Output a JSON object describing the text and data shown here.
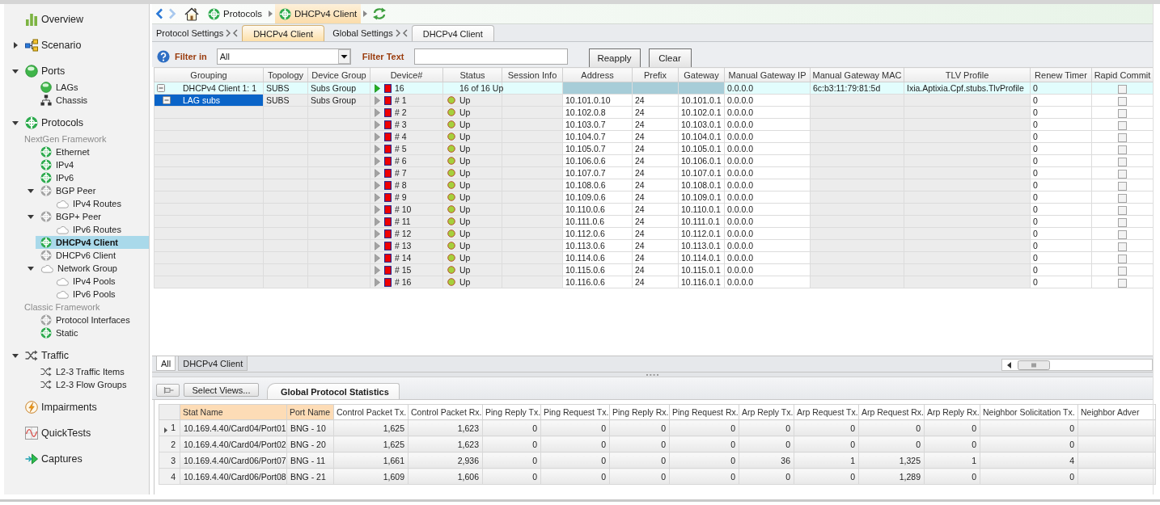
{
  "sidebar": {
    "items": [
      {
        "kind": "overview",
        "label": "Overview",
        "selected": false
      },
      {
        "kind": "scenario",
        "label": "Scenario",
        "selected": false,
        "expanded": false
      },
      {
        "kind": "ports",
        "label": "Ports",
        "selected": false,
        "expanded": true,
        "children": [
          {
            "kind": "lag",
            "label": "LAGs",
            "selected": false
          },
          {
            "kind": "chassis",
            "label": "Chassis",
            "selected": false
          }
        ]
      },
      {
        "kind": "protocol",
        "label": "Protocols",
        "active": true,
        "selected": false,
        "expanded": true,
        "children": [
          {
            "kind": "heading",
            "label": "NextGen Framework"
          },
          {
            "kind": "protocol",
            "label": "Ethernet",
            "active": true,
            "selected": false
          },
          {
            "kind": "protocol",
            "label": "IPv4",
            "active": true,
            "selected": false
          },
          {
            "kind": "protocol",
            "label": "IPv6",
            "active": true,
            "selected": false
          },
          {
            "kind": "protocol",
            "label": "BGP Peer",
            "active": false,
            "selected": false,
            "expanded": true,
            "children": [
              {
                "kind": "cloud",
                "label": "IPv4 Routes",
                "selected": false
              }
            ]
          },
          {
            "kind": "protocol",
            "label": "BGP+ Peer",
            "active": false,
            "selected": false,
            "expanded": true,
            "children": [
              {
                "kind": "cloud",
                "label": "IPv6 Routes",
                "selected": false
              }
            ]
          },
          {
            "kind": "protocol",
            "label": "DHCPv4 Client",
            "active": true,
            "selected": true
          },
          {
            "kind": "protocol",
            "label": "DHCPv6 Client",
            "active": false,
            "selected": false
          },
          {
            "kind": "cloud",
            "label": "Network Group",
            "selected": false,
            "expanded": true,
            "children": [
              {
                "kind": "cloud",
                "label": "IPv4 Pools",
                "selected": false
              },
              {
                "kind": "cloud",
                "label": "IPv6 Pools",
                "selected": false
              }
            ]
          },
          {
            "kind": "heading",
            "label": "Classic Framework"
          },
          {
            "kind": "protocol",
            "label": "Protocol Interfaces",
            "active": false,
            "selected": false
          },
          {
            "kind": "protocol",
            "label": "Static",
            "active": true,
            "selected": false
          }
        ]
      },
      {
        "kind": "traffic",
        "label": "Traffic",
        "selected": false,
        "expanded": true,
        "children": [
          {
            "kind": "traffic",
            "label": "L2-3 Traffic Items",
            "selected": false
          },
          {
            "kind": "traffic",
            "label": "L2-3 Flow Groups",
            "selected": false
          }
        ]
      },
      {
        "kind": "impairments",
        "label": "Impairments",
        "selected": false
      },
      {
        "kind": "quicktests",
        "label": "QuickTests",
        "selected": false
      },
      {
        "kind": "captures",
        "label": "Captures",
        "selected": false
      }
    ]
  },
  "navigation": {
    "back_enabled": true,
    "forward_enabled": false
  },
  "breadcrumb": [
    {
      "label": "Protocols",
      "selected": false
    },
    {
      "label": "DHCPv4 Client",
      "selected": true
    }
  ],
  "settings_tabs": [
    {
      "label": "Protocol Settings",
      "tabs": [
        {
          "label": "DHCPv4 Client",
          "selected": true
        }
      ]
    },
    {
      "label": "Global Settings",
      "tabs": [
        {
          "label": "DHCPv4 Client",
          "selected": false
        }
      ]
    }
  ],
  "filter": {
    "scope_label": "Filter in",
    "scope": "All",
    "text_label": "Filter Text",
    "buttons": [
      "Reapply",
      "Clear"
    ]
  },
  "grid": {
    "columns": [
      {
        "label": "Grouping",
        "editable": false
      },
      {
        "label": "Topology",
        "editable": false
      },
      {
        "label": "Device Group",
        "editable": false
      },
      {
        "label": "Device#",
        "editable": false
      },
      {
        "label": "Status",
        "editable": false
      },
      {
        "label": "Session Info",
        "editable": false
      },
      {
        "label": "Address",
        "editable": true
      },
      {
        "label": "Prefix",
        "editable": true
      },
      {
        "label": "Gateway",
        "editable": true
      },
      {
        "label": "Manual Gateway IP",
        "editable": true
      },
      {
        "label": "Manual Gateway MAC",
        "editable": false
      },
      {
        "label": "TLV Profile",
        "editable": false
      },
      {
        "label": "Renew Timer",
        "editable": true
      },
      {
        "label": "Rapid Commit",
        "editable": true
      }
    ],
    "rows": [
      {
        "grouping": "DHCPv4 Client 1: 1",
        "topology": "SUBS",
        "device_group": "Subs Group",
        "device": "16",
        "status": "16 of 16 Up",
        "manual_gateway_ip": "0.0.0.0",
        "manual_gateway_mac": "6c:b3:11:79:81:5d",
        "tlv_profile": "Ixia.Aptixia.Cpf.stubs.TlvProfile",
        "renew_timer": "0",
        "rapid_commit": false,
        "expanded": true,
        "selected": false,
        "children": [
          {
            "grouping": "LAG subs",
            "topology": "SUBS",
            "device_group": "Subs Group",
            "expanded": true,
            "selected": true,
            "devices": [
              {
                "device": "# 1",
                "status": "Up",
                "address": "10.101.0.10",
                "prefix": "24",
                "gateway": "10.101.0.1",
                "manual_gateway_ip": "0.0.0.0",
                "renew_timer": "0",
                "rapid_commit": false,
                "selected": false
              },
              {
                "device": "# 2",
                "status": "Up",
                "address": "10.102.0.8",
                "prefix": "24",
                "gateway": "10.102.0.1",
                "manual_gateway_ip": "0.0.0.0",
                "renew_timer": "0",
                "rapid_commit": false,
                "selected": false
              },
              {
                "device": "# 3",
                "status": "Up",
                "address": "10.103.0.7",
                "prefix": "24",
                "gateway": "10.103.0.1",
                "manual_gateway_ip": "0.0.0.0",
                "renew_timer": "0",
                "rapid_commit": false,
                "selected": false
              },
              {
                "device": "# 4",
                "status": "Up",
                "address": "10.104.0.7",
                "prefix": "24",
                "gateway": "10.104.0.1",
                "manual_gateway_ip": "0.0.0.0",
                "renew_timer": "0",
                "rapid_commit": false,
                "selected": false
              },
              {
                "device": "# 5",
                "status": "Up",
                "address": "10.105.0.7",
                "prefix": "24",
                "gateway": "10.105.0.1",
                "manual_gateway_ip": "0.0.0.0",
                "renew_timer": "0",
                "rapid_commit": false,
                "selected": false
              },
              {
                "device": "# 6",
                "status": "Up",
                "address": "10.106.0.6",
                "prefix": "24",
                "gateway": "10.106.0.1",
                "manual_gateway_ip": "0.0.0.0",
                "renew_timer": "0",
                "rapid_commit": false,
                "selected": false
              },
              {
                "device": "# 7",
                "status": "Up",
                "address": "10.107.0.7",
                "prefix": "24",
                "gateway": "10.107.0.1",
                "manual_gateway_ip": "0.0.0.0",
                "renew_timer": "0",
                "rapid_commit": false,
                "selected": false
              },
              {
                "device": "# 8",
                "status": "Up",
                "address": "10.108.0.6",
                "prefix": "24",
                "gateway": "10.108.0.1",
                "manual_gateway_ip": "0.0.0.0",
                "renew_timer": "0",
                "rapid_commit": false,
                "selected": false
              },
              {
                "device": "# 9",
                "status": "Up",
                "address": "10.109.0.6",
                "prefix": "24",
                "gateway": "10.109.0.1",
                "manual_gateway_ip": "0.0.0.0",
                "renew_timer": "0",
                "rapid_commit": false,
                "selected": false
              },
              {
                "device": "# 10",
                "status": "Up",
                "address": "10.110.0.6",
                "prefix": "24",
                "gateway": "10.110.0.1",
                "manual_gateway_ip": "0.0.0.0",
                "renew_timer": "0",
                "rapid_commit": false,
                "selected": false
              },
              {
                "device": "# 11",
                "status": "Up",
                "address": "10.111.0.6",
                "prefix": "24",
                "gateway": "10.111.0.1",
                "manual_gateway_ip": "0.0.0.0",
                "renew_timer": "0",
                "rapid_commit": false,
                "selected": false
              },
              {
                "device": "# 12",
                "status": "Up",
                "address": "10.112.0.6",
                "prefix": "24",
                "gateway": "10.112.0.1",
                "manual_gateway_ip": "0.0.0.0",
                "renew_timer": "0",
                "rapid_commit": false,
                "selected": false
              },
              {
                "device": "# 13",
                "status": "Up",
                "address": "10.113.0.6",
                "prefix": "24",
                "gateway": "10.113.0.1",
                "manual_gateway_ip": "0.0.0.0",
                "renew_timer": "0",
                "rapid_commit": false,
                "selected": false
              },
              {
                "device": "# 14",
                "status": "Up",
                "address": "10.114.0.6",
                "prefix": "24",
                "gateway": "10.114.0.1",
                "manual_gateway_ip": "0.0.0.0",
                "renew_timer": "0",
                "rapid_commit": false,
                "selected": false
              },
              {
                "device": "# 15",
                "status": "Up",
                "address": "10.115.0.6",
                "prefix": "24",
                "gateway": "10.115.0.1",
                "manual_gateway_ip": "0.0.0.0",
                "renew_timer": "0",
                "rapid_commit": false,
                "selected": false
              },
              {
                "device": "# 16",
                "status": "Up",
                "address": "10.116.0.6",
                "prefix": "24",
                "gateway": "10.116.0.1",
                "manual_gateway_ip": "0.0.0.0",
                "renew_timer": "0",
                "rapid_commit": false,
                "selected": false
              }
            ]
          }
        ]
      }
    ],
    "view_tabs": [
      {
        "label": "All",
        "selected": true
      },
      {
        "label": "DHCPv4 Client",
        "selected": false
      }
    ]
  },
  "stats": {
    "select_views": "Select Views...",
    "tabs": [
      {
        "label": "Global Protocol Statistics",
        "selected": true
      }
    ],
    "columns": [
      {
        "label": "Stat Name",
        "frozen": true
      },
      {
        "label": "Port Name",
        "frozen": true
      },
      {
        "label": "Control Packet Tx.",
        "frozen": false
      },
      {
        "label": "Control Packet Rx.",
        "frozen": false
      },
      {
        "label": "Ping Reply Tx.",
        "frozen": false
      },
      {
        "label": "Ping Request Tx.",
        "frozen": false
      },
      {
        "label": "Ping Reply Rx.",
        "frozen": false
      },
      {
        "label": "Ping Request Rx.",
        "frozen": false
      },
      {
        "label": "Arp Reply Tx.",
        "frozen": false
      },
      {
        "label": "Arp Request Tx.",
        "frozen": false
      },
      {
        "label": "Arp Request Rx.",
        "frozen": false
      },
      {
        "label": "Arp Reply Rx.",
        "frozen": false
      },
      {
        "label": "Neighbor Solicitation Tx.",
        "frozen": false
      },
      {
        "label": "Neighbor Adver",
        "frozen": false
      }
    ],
    "rows": [
      {
        "index": "1",
        "selected": true,
        "cells": [
          "10.169.4.40/Card04/Port01",
          "BNG - 10",
          "1,625",
          "1,623",
          "0",
          "0",
          "0",
          "0",
          "0",
          "0",
          "0",
          "0",
          "0"
        ]
      },
      {
        "index": "2",
        "selected": false,
        "cells": [
          "10.169.4.40/Card04/Port02",
          "BNG - 20",
          "1,625",
          "1,623",
          "0",
          "0",
          "0",
          "0",
          "0",
          "0",
          "0",
          "0",
          "0"
        ]
      },
      {
        "index": "3",
        "selected": false,
        "cells": [
          "10.169.4.40/Card06/Port07",
          "BNG - 11",
          "1,661",
          "2,936",
          "0",
          "0",
          "0",
          "0",
          "36",
          "1",
          "1,325",
          "1",
          "4"
        ]
      },
      {
        "index": "4",
        "selected": false,
        "cells": [
          "10.169.4.40/Card06/Port08",
          "BNG - 21",
          "1,609",
          "1,606",
          "0",
          "0",
          "0",
          "0",
          "0",
          "0",
          "1,289",
          "0",
          "0"
        ]
      }
    ]
  }
}
